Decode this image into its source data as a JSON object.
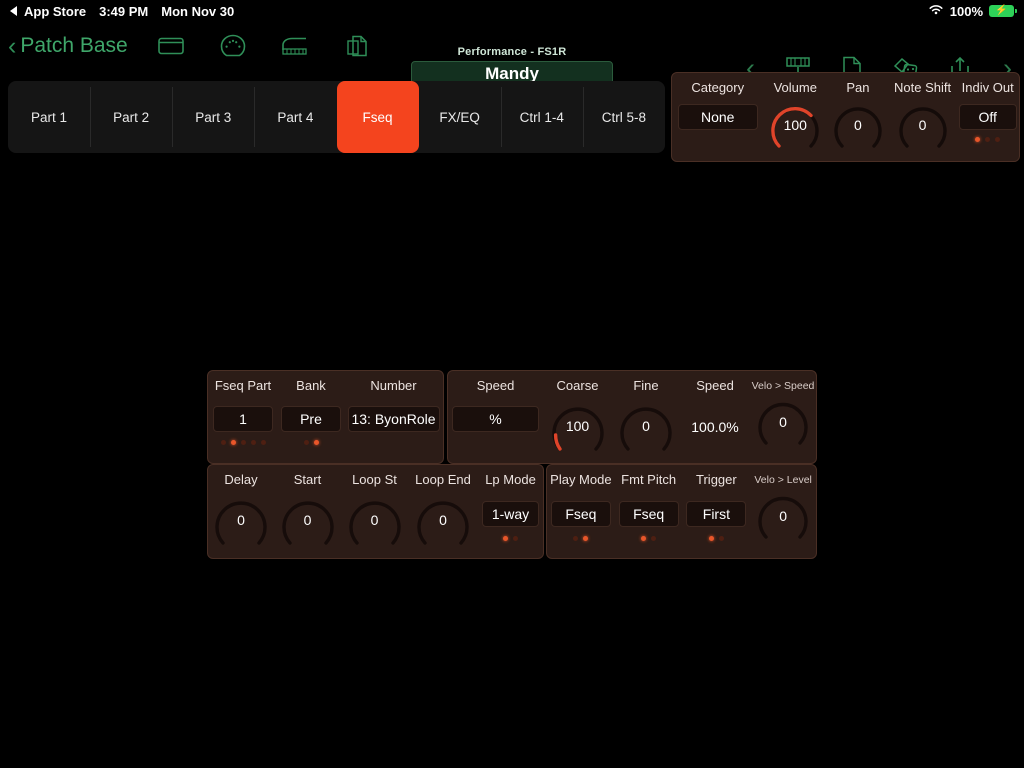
{
  "status_bar": {
    "back_app": "App Store",
    "time": "3:49 PM",
    "date": "Mon Nov 30",
    "battery_percent": "100%",
    "wifi_icon": "wifi-icon",
    "battery_icon": "battery-charging-icon"
  },
  "nav": {
    "back_label": "Patch Base",
    "left_icons": [
      "window-icon",
      "midi-din-icon",
      "piano-keyboard-icon",
      "document-copy-icon"
    ],
    "right_icons": [
      "chevron-left-icon",
      "send-to-synth-icon",
      "new-document-icon",
      "randomize-dice-icon",
      "share-export-icon",
      "chevron-right-icon"
    ]
  },
  "performance": {
    "label": "Performance - FS1R",
    "name": "Mandy"
  },
  "tabs": [
    {
      "label": "Part 1",
      "active": false
    },
    {
      "label": "Part 2",
      "active": false
    },
    {
      "label": "Part 3",
      "active": false
    },
    {
      "label": "Part 4",
      "active": false
    },
    {
      "label": "Fseq",
      "active": true
    },
    {
      "label": "FX/EQ",
      "active": false
    },
    {
      "label": "Ctrl 1-4",
      "active": false
    },
    {
      "label": "Ctrl 5-8",
      "active": false
    }
  ],
  "top_params": {
    "category": {
      "label": "Category",
      "value": "None"
    },
    "volume": {
      "label": "Volume",
      "value": "100"
    },
    "pan": {
      "label": "Pan",
      "value": "0"
    },
    "note_shift": {
      "label": "Note Shift",
      "value": "0"
    },
    "indiv_out": {
      "label": "Indiv Out",
      "value": "Off"
    },
    "page_dots": {
      "count": 3,
      "active": 0
    }
  },
  "fseq_select": {
    "fseq_part": {
      "label": "Fseq Part",
      "value": "1",
      "dots": {
        "count": 5,
        "active": 1
      }
    },
    "bank": {
      "label": "Bank",
      "value": "Pre",
      "dots": {
        "count": 2,
        "active": 1
      }
    },
    "number": {
      "label": "Number",
      "value": "13: ByonRole"
    }
  },
  "fseq_speed": {
    "speed_unit": {
      "label": "Speed",
      "value": "%"
    },
    "coarse": {
      "label": "Coarse",
      "value": "100"
    },
    "fine": {
      "label": "Fine",
      "value": "0"
    },
    "speed_readout": {
      "label": "Speed",
      "value": "100.0%"
    },
    "velo_speed": {
      "label": "Velo > Speed",
      "value": "0"
    }
  },
  "fseq_loop": {
    "delay": {
      "label": "Delay",
      "value": "0"
    },
    "start": {
      "label": "Start",
      "value": "0"
    },
    "loop_st": {
      "label": "Loop St",
      "value": "0"
    },
    "loop_end": {
      "label": "Loop End",
      "value": "0"
    },
    "lp_mode": {
      "label": "Lp Mode",
      "value": "1-way",
      "dots": {
        "count": 2,
        "active": 0
      }
    }
  },
  "fseq_play": {
    "play_mode": {
      "label": "Play Mode",
      "value": "Fseq",
      "dots": {
        "count": 2,
        "active": 1
      }
    },
    "fmt_pitch": {
      "label": "Fmt Pitch",
      "value": "Fseq",
      "dots": {
        "count": 2,
        "active": 0
      }
    },
    "trigger": {
      "label": "Trigger",
      "value": "First",
      "dots": {
        "count": 2,
        "active": 0
      }
    },
    "velo_level": {
      "label": "Velo > Level",
      "value": "0"
    }
  },
  "colors": {
    "accent_orange": "#f4441e",
    "knob_active": "#e0442a",
    "panel_bg": "#2c1c17",
    "nav_green": "#3fa76a",
    "tab_bg": "#151515"
  }
}
